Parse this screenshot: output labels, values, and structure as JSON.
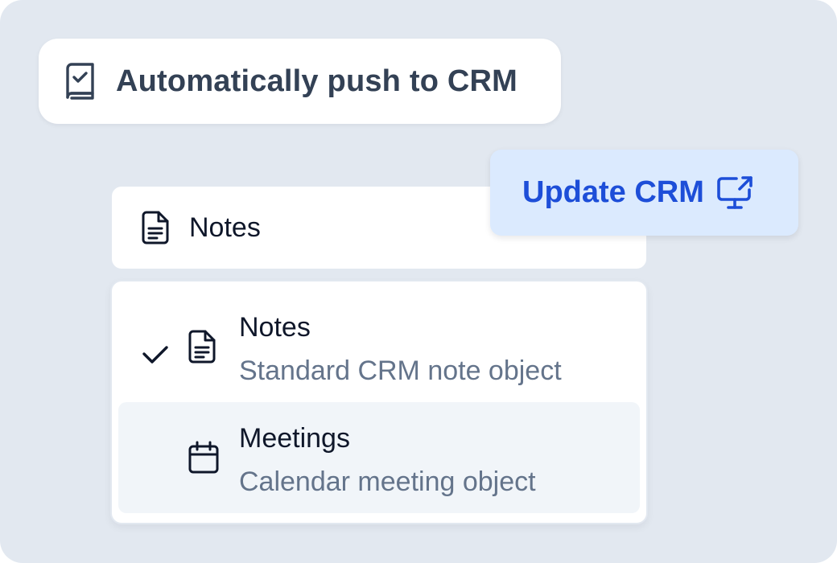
{
  "colors": {
    "background": "#e2e8f0",
    "card": "#ffffff",
    "accent": "#1d4ed8",
    "accent_bg": "#dbeafe",
    "text_primary": "#0f172a",
    "text_muted": "#64748b",
    "highlight": "#f1f5f9"
  },
  "chip": {
    "icon": "book-check-icon",
    "label": "Automatically push to CRM"
  },
  "select": {
    "icon": "document-icon",
    "value": "Notes"
  },
  "update_button": {
    "label": "Update CRM",
    "icon": "monitor-export-icon"
  },
  "menu": {
    "options": [
      {
        "title": "Notes",
        "description": "Standard CRM note object",
        "icon": "document-icon",
        "selected": true
      },
      {
        "title": "Meetings",
        "description": "Calendar meeting object",
        "icon": "calendar-icon",
        "selected": false,
        "highlighted": true
      }
    ]
  }
}
